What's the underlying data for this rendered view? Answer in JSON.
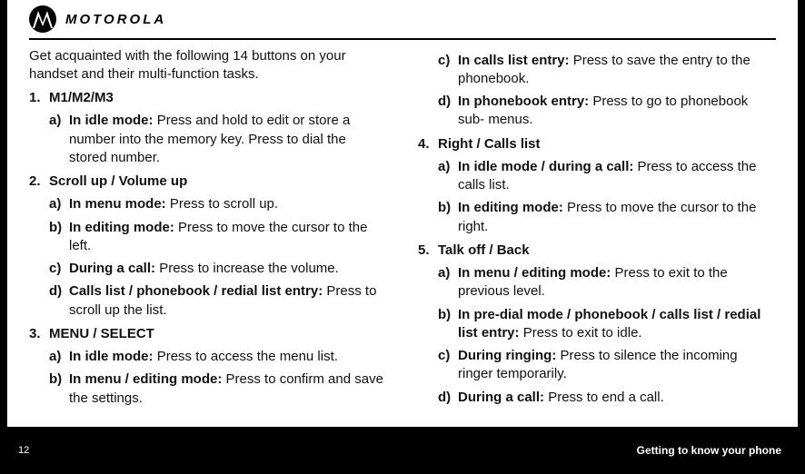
{
  "header": {
    "brand": "MOTOROLA"
  },
  "intro": "Get acquainted with the following 14 buttons on your handset and their multi-function tasks.",
  "items": [
    {
      "num": "1.",
      "title": "M1/M2/M3",
      "subs": [
        {
          "letter": "a)",
          "bold": "In idle mode:",
          "text": "Press and hold to edit or store a number into the memory key. Press to dial the stored number."
        }
      ]
    },
    {
      "num": "2.",
      "title": "Scroll up / Volume up",
      "subs": [
        {
          "letter": "a)",
          "bold": "In menu mode:",
          "text": "Press to scroll up."
        },
        {
          "letter": "b)",
          "bold": "In editing mode:",
          "text": "Press to move the cursor to the left."
        },
        {
          "letter": "c)",
          "bold": "During a call:",
          "text": "Press to increase the volume."
        },
        {
          "letter": "d)",
          "bold": "Calls list / phonebook / redial list entry:",
          "text": "Press to scroll up the list."
        }
      ]
    },
    {
      "num": "3.",
      "title": "MENU / SELECT",
      "subs": [
        {
          "letter": "a)",
          "bold": "In idle mode:",
          "text": "Press to access the menu list."
        },
        {
          "letter": "b)",
          "bold": "In menu / editing mode:",
          "text": "Press to confirm and save the settings."
        },
        {
          "letter": "c)",
          "bold": "In calls list entry:",
          "text": "Press to save the entry to the phonebook."
        },
        {
          "letter": "d)",
          "bold": "In phonebook entry:",
          "text": "Press to go to phonebook sub- menus."
        }
      ]
    },
    {
      "num": "4.",
      "title": "Right / Calls list",
      "subs": [
        {
          "letter": "a)",
          "bold": "In idle mode / during a call:",
          "text": "Press to access the calls list."
        },
        {
          "letter": "b)",
          "bold": "In editing mode:",
          "text": "Press to move the cursor to the right."
        }
      ]
    },
    {
      "num": "5.",
      "title": "Talk off / Back",
      "subs": [
        {
          "letter": "a)",
          "bold": "In menu / editing mode:",
          "text": "Press to exit to the previous level."
        },
        {
          "letter": "b)",
          "bold": "In pre-dial mode / phonebook / calls list / redial list entry:",
          "text": "Press to exit to idle."
        },
        {
          "letter": "c)",
          "bold": "During ringing:",
          "text": "Press to silence the incoming ringer temporarily."
        },
        {
          "letter": "d)",
          "bold": "During a call:",
          "text": "Press to end a call."
        }
      ]
    }
  ],
  "footer": {
    "page": "12",
    "section": "Getting to know your phone"
  }
}
